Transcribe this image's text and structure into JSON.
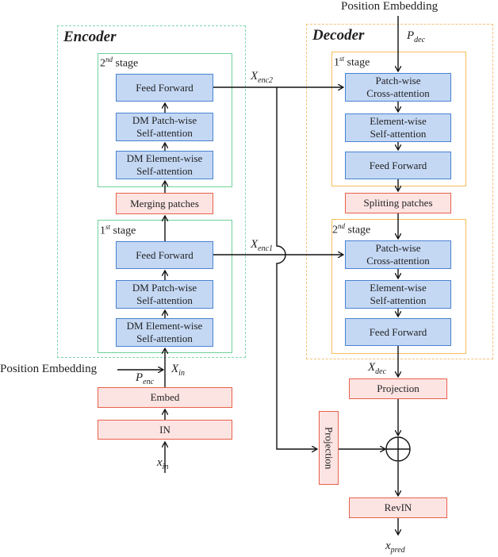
{
  "encoder": {
    "title": "Encoder",
    "stage2": {
      "label_num": "2",
      "label_sup": "nd",
      "label_text": "stage",
      "blocks": [
        {
          "line1": "Feed Forward",
          "line2": ""
        },
        {
          "line1": "DM Patch-wise",
          "line2": "Self-attention"
        },
        {
          "line1": "DM Element-wise",
          "line2": "Self-attention"
        }
      ]
    },
    "merging": "Merging patches",
    "stage1": {
      "label_num": "1",
      "label_sup": "st",
      "label_text": "stage",
      "blocks": [
        {
          "line1": "Feed Forward",
          "line2": ""
        },
        {
          "line1": "DM Patch-wise",
          "line2": "Self-attention"
        },
        {
          "line1": "DM Element-wise",
          "line2": "Self-attention"
        }
      ]
    },
    "embed": "Embed",
    "in": "IN",
    "position_embedding": "Position Embedding",
    "p_enc": {
      "base": "P",
      "sub": "enc"
    },
    "x_in": {
      "base": "X",
      "sub": "in"
    },
    "input": {
      "base": "x",
      "sub": "in"
    }
  },
  "decoder": {
    "title": "Decoder",
    "position_embedding": "Position Embedding",
    "p_dec": {
      "base": "P",
      "sub": "dec"
    },
    "stage1": {
      "label_num": "1",
      "label_sup": "st",
      "label_text": "stage",
      "blocks": [
        {
          "line1": "Patch-wise",
          "line2": "Cross-attention"
        },
        {
          "line1": "Element-wise",
          "line2": "Self-attention"
        },
        {
          "line1": "Feed Forward",
          "line2": ""
        }
      ]
    },
    "splitting": "Splitting patches",
    "stage2": {
      "label_num": "2",
      "label_sup": "nd",
      "label_text": "stage",
      "blocks": [
        {
          "line1": "Patch-wise",
          "line2": "Cross-attention"
        },
        {
          "line1": "Element-wise",
          "line2": "Self-attention"
        },
        {
          "line1": "Feed Forward",
          "line2": ""
        }
      ]
    },
    "x_dec": {
      "base": "X",
      "sub": "dec"
    }
  },
  "connections": {
    "x_enc2": {
      "base": "X",
      "sub": "enc2"
    },
    "x_enc1": {
      "base": "X",
      "sub": "enc1"
    }
  },
  "head": {
    "projection_main": "Projection",
    "projection_skip": "Projection",
    "revin": "RevIN",
    "output": {
      "base": "x",
      "sub": "pred"
    },
    "sum_symbol": "plus-circle"
  }
}
